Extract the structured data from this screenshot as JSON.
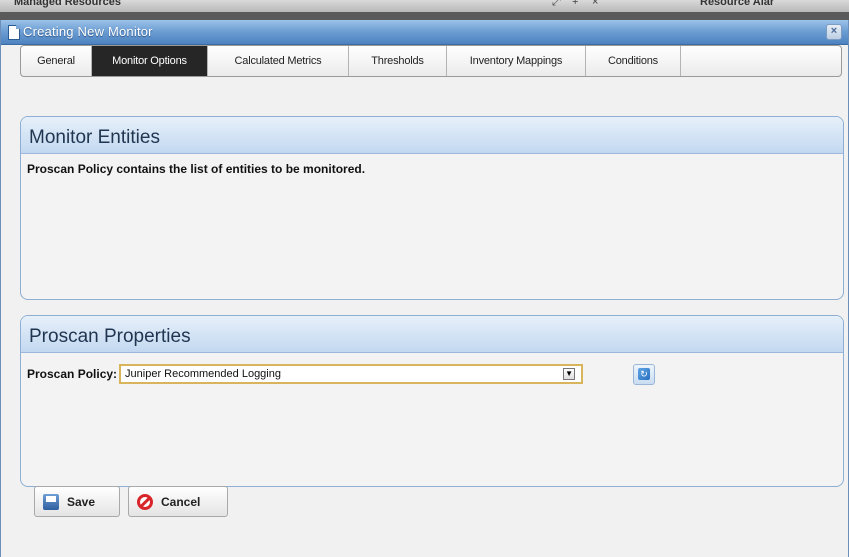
{
  "background": {
    "left_title": "Managed Resources",
    "right_title": "Resource Alar",
    "controls": [
      "⤢",
      "+",
      "×"
    ]
  },
  "dialog": {
    "title": "Creating New Monitor",
    "close_symbol": "×"
  },
  "tabs": [
    {
      "label": "General",
      "active": false
    },
    {
      "label": "Monitor Options",
      "active": true
    },
    {
      "label": "Calculated Metrics",
      "active": false
    },
    {
      "label": "Thresholds",
      "active": false
    },
    {
      "label": "Inventory Mappings",
      "active": false
    },
    {
      "label": "Conditions",
      "active": false
    }
  ],
  "monitor_entities": {
    "heading": "Monitor Entities",
    "description": "Proscan Policy contains the list of entities to be monitored."
  },
  "proscan_properties": {
    "heading": "Proscan Properties",
    "policy_label": "Proscan Policy:",
    "policy_value": "Juniper Recommended Logging",
    "refresh_icon": "refresh-icon"
  },
  "buttons": {
    "save": "Save",
    "cancel": "Cancel"
  },
  "colors": {
    "titlebar": "#4d82c0",
    "active_tab": "#262626",
    "panel_border": "#8eaed4",
    "select_border": "#d8b45a"
  }
}
